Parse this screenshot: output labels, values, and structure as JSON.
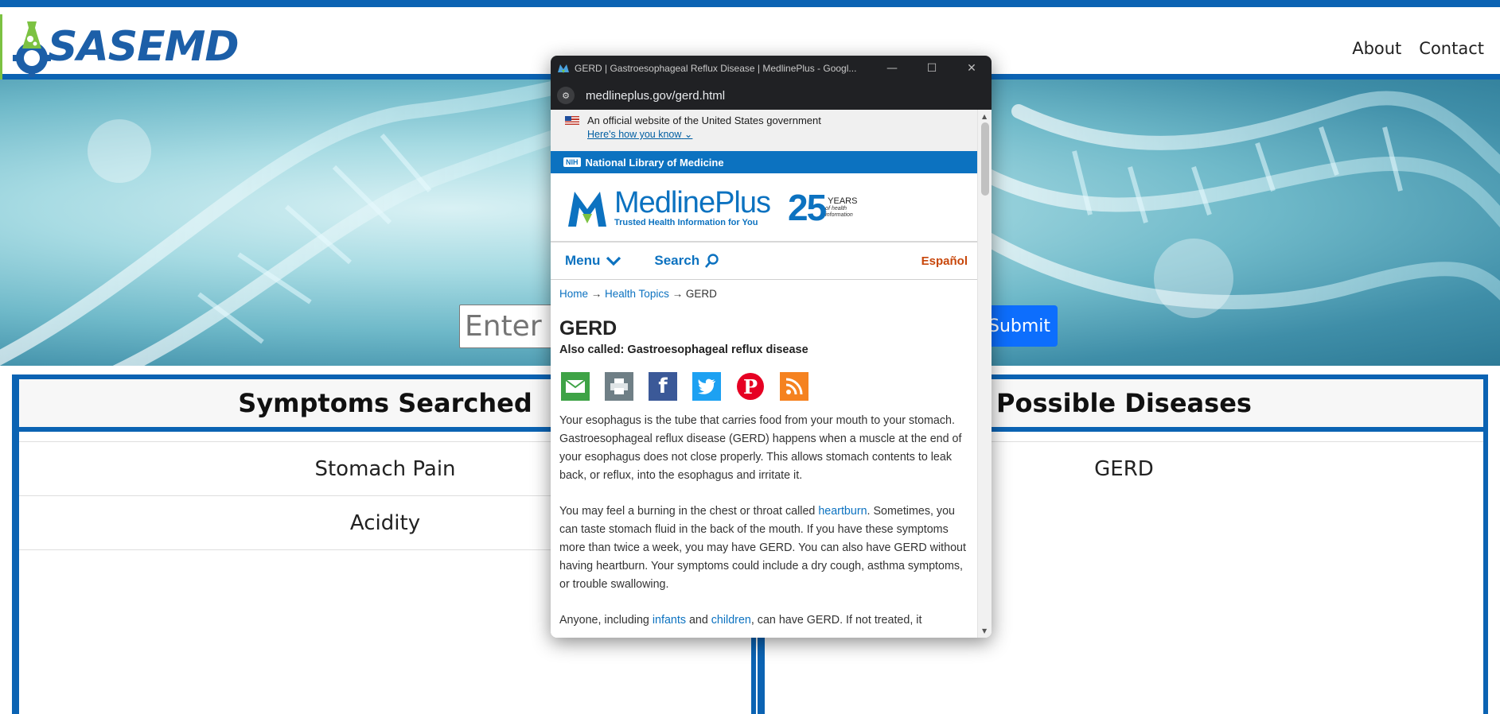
{
  "site": {
    "logo_text": "SASEMD",
    "nav": {
      "about": "About",
      "contact": "Contact"
    },
    "search": {
      "placeholder": "Enter Symptoms",
      "submit": "Submit"
    },
    "left_panel": {
      "title": "Symptoms Searched",
      "rows": [
        "Stomach Pain",
        "Acidity"
      ]
    },
    "right_panel": {
      "title": "Possible Diseases",
      "rows": [
        "GERD"
      ]
    },
    "colors": {
      "brand_blue": "#0b63b3",
      "submit": "#0d6efd",
      "logo_green": "#7cc242"
    }
  },
  "popup": {
    "window_title": "GERD | Gastroesophageal Reflux Disease | MedlinePlus - Googl...",
    "controls": {
      "minimize": "—",
      "maximize": "☐",
      "close": "✕"
    },
    "url": "medlineplus.gov/gerd.html",
    "gov_banner": {
      "text": "An official website of the United States government",
      "link": "Here's how you know"
    },
    "nlm": {
      "badge": "NIH",
      "text": "National Library of Medicine"
    },
    "brand": {
      "name": "MedlinePlus",
      "tagline": "Trusted Health Information for You",
      "years_num": "25",
      "years_label": "YEARS",
      "years_sub1": "of health",
      "years_sub2": "information"
    },
    "menu": {
      "menu": "Menu",
      "search": "Search",
      "espanol": "Español"
    },
    "breadcrumb": {
      "home": "Home",
      "sep": " → ",
      "health_topics": "Health Topics",
      "current": "GERD"
    },
    "title": "GERD",
    "also_called": "Also called: Gastroesophageal reflux disease",
    "share_icons": [
      "email-icon",
      "print-icon",
      "facebook-icon",
      "twitter-icon",
      "pinterest-icon",
      "rss-icon"
    ],
    "para1": "Your esophagus is the tube that carries food from your mouth to your stomach. Gastroesophageal reflux disease (GERD) happens when a muscle at the end of your esophagus does not close properly. This allows stomach contents to leak back, or reflux, into the esophagus and irritate it.",
    "para2": {
      "before": "You may feel a burning in the chest or throat called ",
      "link": "heartburn",
      "after": ". Sometimes, you can taste stomach fluid in the back of the mouth. If you have these symptoms more than twice a week, you may have GERD. You can also have GERD without having heartburn. Your symptoms could include a dry cough, asthma symptoms, or trouble swallowing."
    },
    "para3": {
      "before": "Anyone, including ",
      "link1": "infants",
      "mid": " and ",
      "link2": "children",
      "after": ", can have GERD. If not treated, it"
    }
  }
}
